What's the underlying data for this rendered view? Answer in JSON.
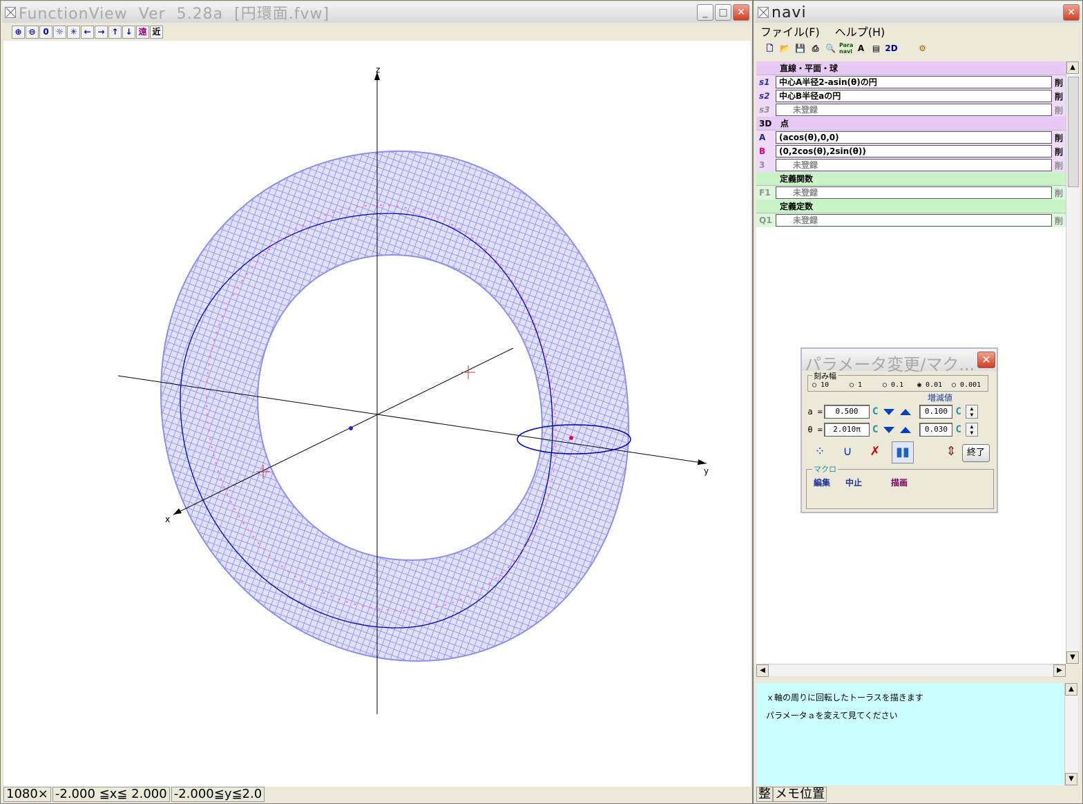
{
  "functionview": {
    "title": "FunctionView  Ver  5.28a  [円環面.fvw]",
    "toolbar": [
      "⊕",
      "⊖",
      "0",
      "☼",
      "✳",
      "←",
      "→",
      "↑",
      "↓",
      "遠",
      "近"
    ],
    "axes": {
      "x": "x",
      "y": "y",
      "z": "z"
    },
    "status": [
      "1080×",
      "-2.000 ≦x≦ 2.000",
      "-2.000≦y≦2.0"
    ]
  },
  "navi": {
    "title": "navi",
    "menu": [
      "ファイル(F)",
      "ヘルプ(H)"
    ],
    "toolbar_2d": "2D",
    "sections": {
      "lines": {
        "header": "直線・平面・球",
        "rows": [
          {
            "label": "s1",
            "value": "中心A半径2-asin(θ)の円",
            "del": "削"
          },
          {
            "label": "s2",
            "value": "中心B半径aの円",
            "del": "削"
          },
          {
            "label": "s3",
            "value": "未登録",
            "del": "削"
          }
        ]
      },
      "points": {
        "header_prefix": "3D",
        "header": "点",
        "rows": [
          {
            "label": "A",
            "value": "(acos(θ),0,0)",
            "del": "削"
          },
          {
            "label": "B",
            "value": "(0,2cos(θ),2sin(θ))",
            "del": "削"
          },
          {
            "label": "3",
            "value": "未登録",
            "del": "削"
          }
        ]
      },
      "funcs": {
        "header": "定義関数",
        "rows": [
          {
            "label": "F1",
            "value": "未登録",
            "del": "削"
          }
        ]
      },
      "consts": {
        "header": "定義定数",
        "rows": [
          {
            "label": "Q1",
            "value": "未登録",
            "del": "削"
          }
        ]
      }
    },
    "description": [
      "ｘ軸の周りに回転したトーラスを描きます",
      "パラメータａを変えて見てください"
    ],
    "status": [
      "整",
      "メモ位置"
    ]
  },
  "param_dialog": {
    "title": "パラメータ変更/マク...",
    "step_legend": "刻み幅",
    "step_options": [
      "10",
      "1",
      "0.1",
      "0.01",
      "0.001"
    ],
    "step_selected": "0.01",
    "increment_label": "増減値",
    "params": [
      {
        "name": "a =",
        "value": "0.500",
        "increment": "0.100"
      },
      {
        "name": "θ =",
        "value": "2.010π",
        "increment": "0.030"
      }
    ],
    "c_label": "C",
    "end_label": "終了",
    "macro_legend": "マクロ",
    "macro_items": [
      "編集",
      "中止",
      "描画"
    ]
  },
  "colors": {
    "torus": "#9999f0",
    "circle": "#0000cc",
    "pink": "#ff66aa",
    "marker": "#cc3333"
  }
}
